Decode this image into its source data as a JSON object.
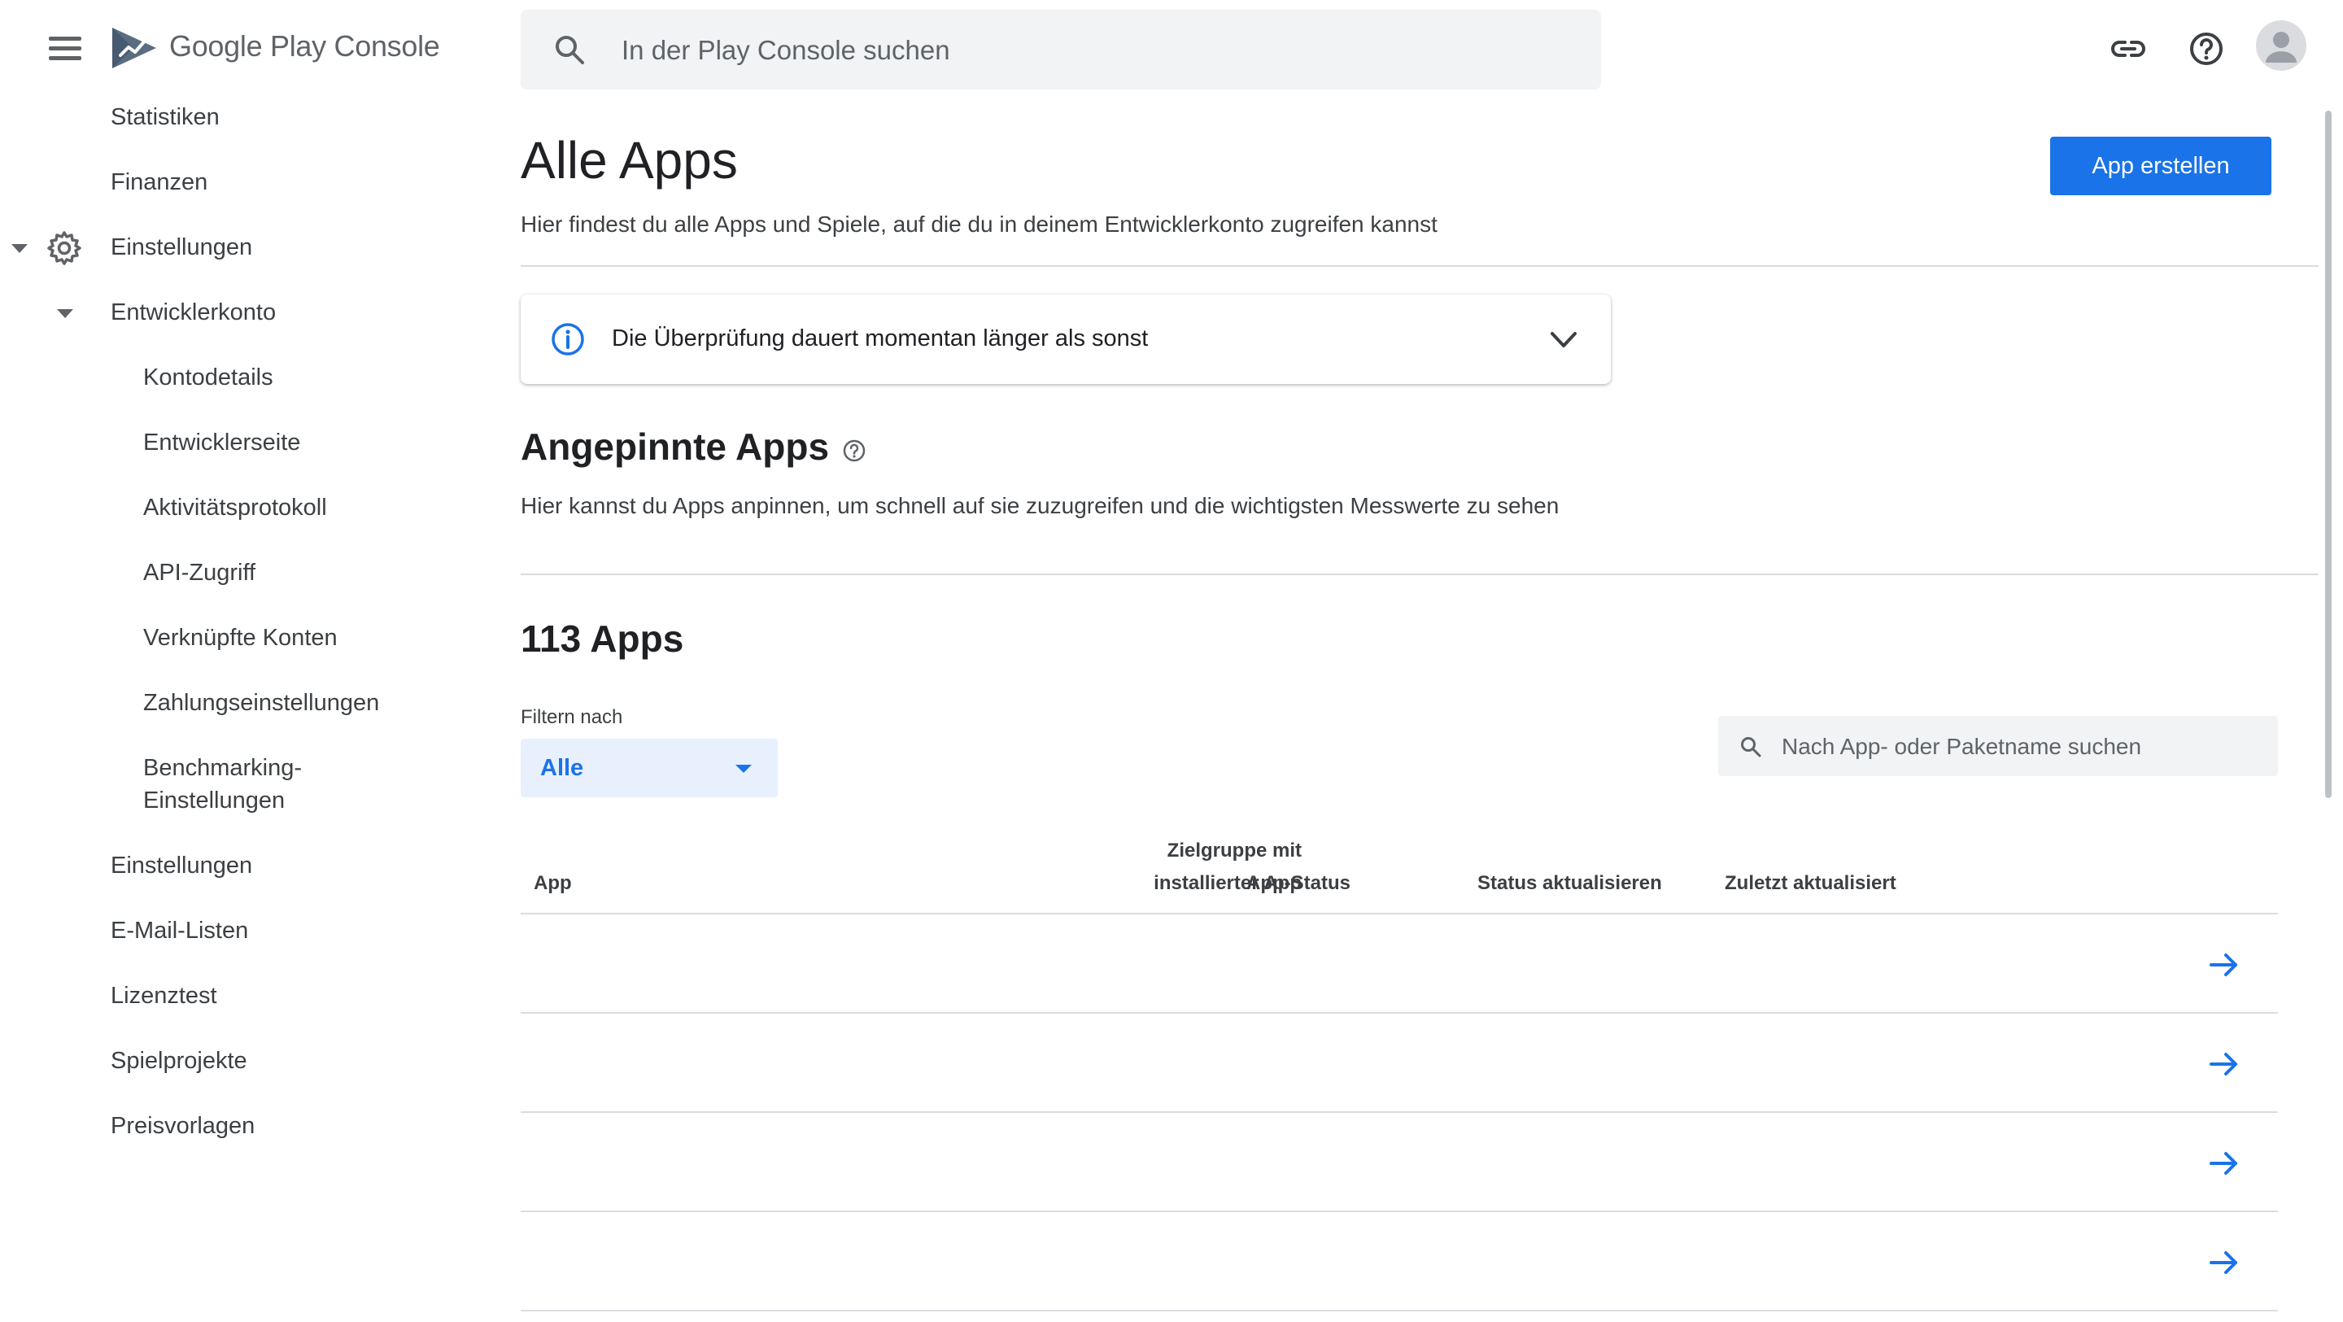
{
  "header": {
    "brand_google": "Google Play",
    "brand_console": "Console",
    "search_placeholder": "In der Play Console suchen"
  },
  "sidebar": {
    "items": [
      {
        "label": "Statistiken"
      },
      {
        "label": "Finanzen"
      },
      {
        "label": "Einstellungen"
      },
      {
        "label": "Entwicklerkonto"
      },
      {
        "label": "Kontodetails"
      },
      {
        "label": "Entwicklerseite"
      },
      {
        "label": "Aktivitätsprotokoll"
      },
      {
        "label": "API-Zugriff"
      },
      {
        "label": "Verknüpfte Konten"
      },
      {
        "label": "Zahlungseinstellungen"
      },
      {
        "label": "Benchmarking-"
      },
      {
        "label": "Einstellungen"
      },
      {
        "label": "Einstellungen"
      },
      {
        "label": "E-Mail-Listen"
      },
      {
        "label": "Lizenztest"
      },
      {
        "label": "Spielprojekte"
      },
      {
        "label": "Preisvorlagen"
      }
    ]
  },
  "main": {
    "title": "Alle Apps",
    "description": "Hier findest du alle Apps und Spiele, auf die du in deinem Entwicklerkonto zugreifen kannst",
    "create_button": "App erstellen",
    "info_banner": "Die Überprüfung dauert momentan länger als sonst",
    "pinned": {
      "title": "Angepinnte Apps",
      "description": "Hier kannst du Apps anpinnen, um schnell auf sie zuzugreifen und die wichtigsten Messwerte zu sehen"
    },
    "apps_count_title": "113 Apps",
    "filter": {
      "label": "Filtern nach",
      "value": "Alle"
    },
    "app_search_placeholder": "Nach App- oder Paketname suchen",
    "table": {
      "headers": {
        "app": "App",
        "audience_line1": "Zielgruppe mit",
        "audience_line2": "installierter App",
        "app_status": "App-Status",
        "update_status": "Status aktualisieren",
        "last_updated": "Zuletzt aktualisiert"
      },
      "row_count_visible": 4
    }
  },
  "colors": {
    "accent": "#1a73e8",
    "text": "#202124",
    "muted": "#5f6368",
    "divider": "#dadce0"
  }
}
